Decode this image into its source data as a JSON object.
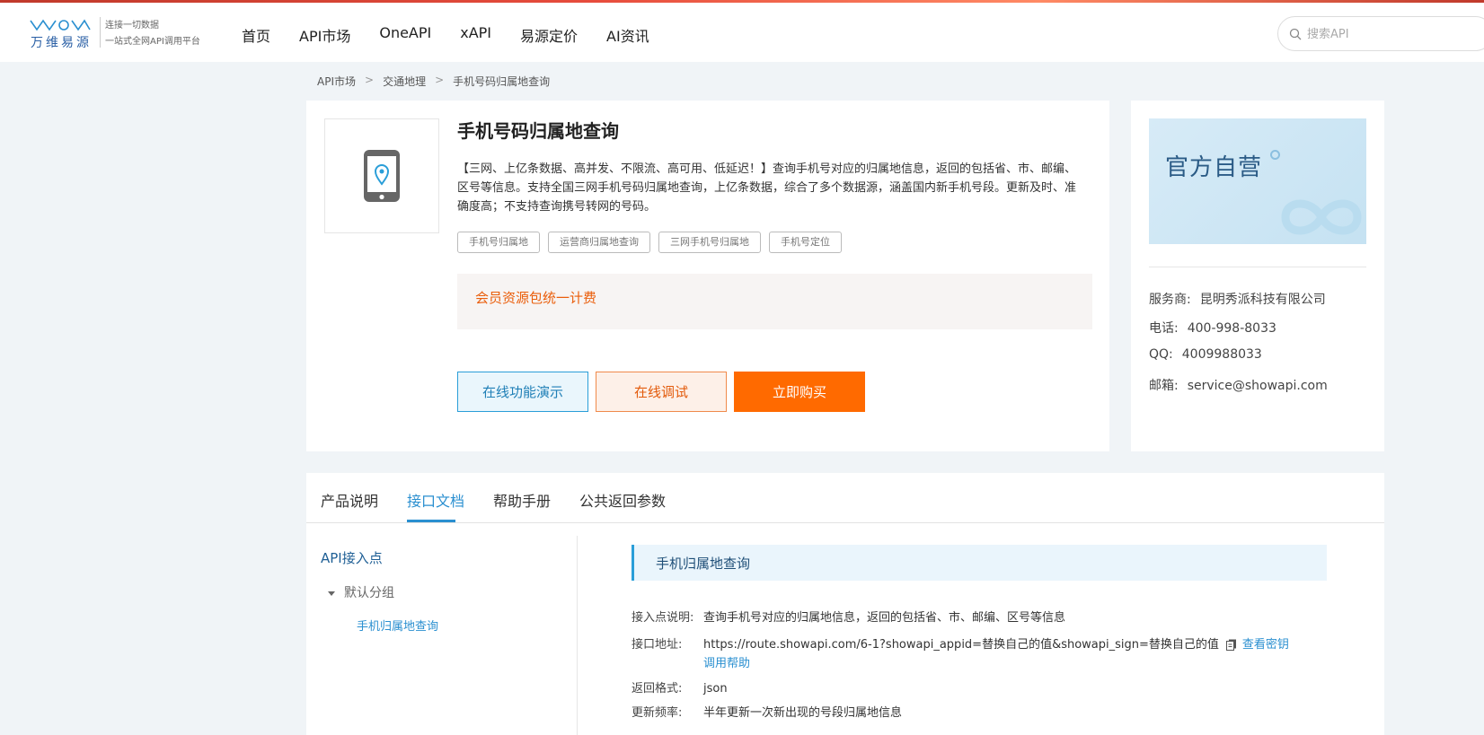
{
  "brand": {
    "name": "万维易源",
    "tagline1": "连接一切数据",
    "tagline2": "一站式全网API调用平台",
    "color": "#2a8fd0"
  },
  "nav": {
    "items": [
      {
        "label": "首页"
      },
      {
        "label": "API市场"
      },
      {
        "label": "OneAPI"
      },
      {
        "label": "xAPI"
      },
      {
        "label": "易源定价"
      },
      {
        "label": "AI资讯"
      }
    ]
  },
  "search": {
    "placeholder": "搜索API",
    "value": "",
    "icon": "search-icon"
  },
  "breadcrumb": {
    "items": [
      "API市场",
      "交通地理",
      "手机号码归属地查询"
    ],
    "separator": ">"
  },
  "product": {
    "title": "手机号码归属地查询",
    "icon": "phone-location-icon",
    "description": "【三网、上亿条数据、高并发、不限流、高可用、低延迟！】查询手机号对应的归属地信息，返回的包括省、市、邮编、区号等信息。支持全国三网手机号码归属地查询，上亿条数据，综合了多个数据源，涵盖国内新手机号段。更新及时、准确度高；不支持查询携号转网的号码。",
    "tags": [
      "手机号归属地",
      "运营商归属地查询",
      "三网手机号归属地",
      "手机号定位"
    ],
    "pricing": "会员资源包统一计费",
    "buttons": {
      "demo": "在线功能演示",
      "debug": "在线调试",
      "buy": "立即购买"
    },
    "colors": {
      "accent_orange": "#ff6a00",
      "accent_blue": "#2a9ed8"
    }
  },
  "provider": {
    "banner_text": "官方自营",
    "fields": [
      {
        "key": "服务商:",
        "value": "昆明秀派科技有限公司"
      },
      {
        "key": "电话:",
        "value": "400-998-8033"
      },
      {
        "key": "QQ:",
        "value": "4009988033"
      },
      {
        "key": "邮箱:",
        "value": "service@showapi.com"
      }
    ]
  },
  "doc": {
    "tabs": [
      {
        "label": "产品说明",
        "active": false
      },
      {
        "label": "接口文档",
        "active": true
      },
      {
        "label": "帮助手册",
        "active": false
      },
      {
        "label": "公共返回参数",
        "active": false
      }
    ],
    "sidebar": {
      "title": "API接入点",
      "group": "默认分组",
      "items": [
        "手机归属地查询"
      ]
    },
    "endpoint": {
      "title": "手机归属地查询",
      "rows": [
        {
          "key": "接入点说明:",
          "value": "查询手机号对应的归属地信息，返回的包括省、市、邮编、区号等信息"
        },
        {
          "key": "接口地址:",
          "value": "https://route.showapi.com/6-1?showapi_appid=替换自己的值&showapi_sign=替换自己的值",
          "link1": "查看密钥",
          "link2": "调用帮助"
        },
        {
          "key": "返回格式:",
          "value": "json"
        },
        {
          "key": "更新频率:",
          "value": "半年更新一次新出现的号段归属地信息"
        }
      ]
    }
  }
}
